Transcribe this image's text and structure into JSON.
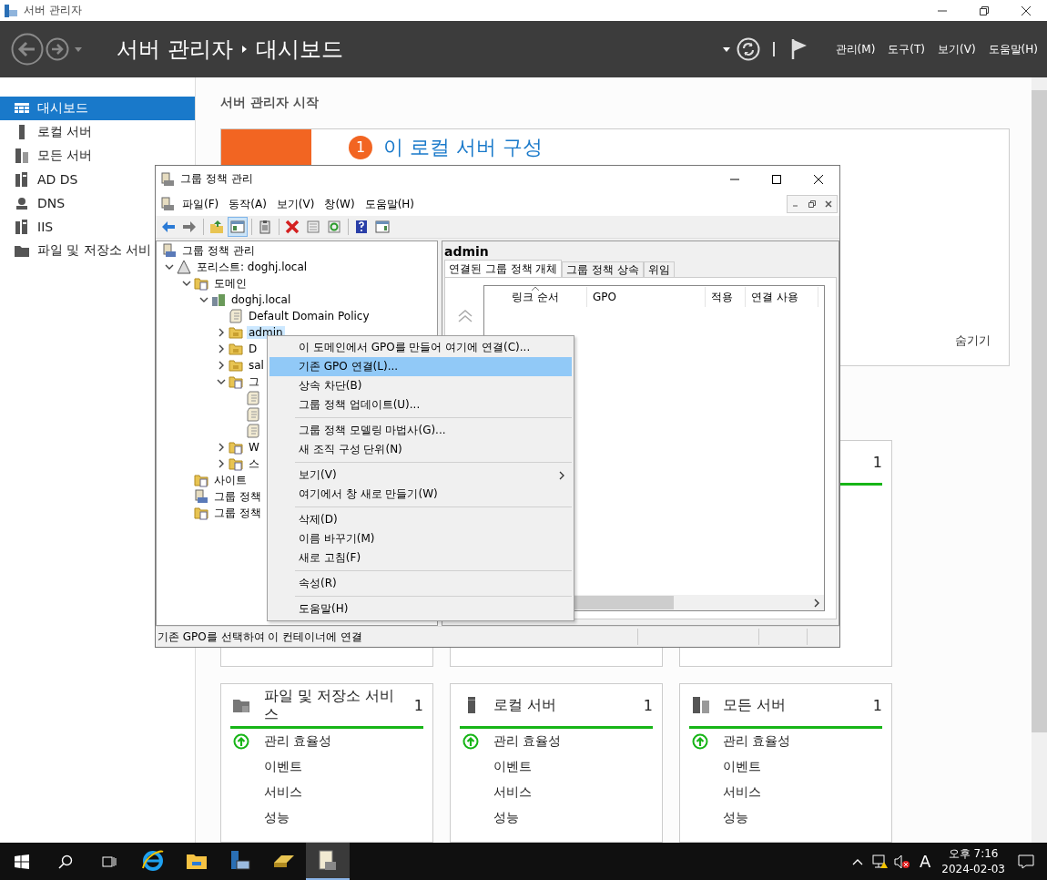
{
  "window": {
    "title": "서버 관리자"
  },
  "header": {
    "breadcrumb": [
      "서버 관리자",
      "대시보드"
    ],
    "menus": [
      "관리(M)",
      "도구(T)",
      "보기(V)",
      "도움말(H)"
    ]
  },
  "sidebar": {
    "items": [
      {
        "label": "대시보드",
        "kind": "dashboard",
        "selected": true
      },
      {
        "label": "로컬 서버",
        "kind": "local-server",
        "selected": false
      },
      {
        "label": "모든 서버",
        "kind": "all-servers",
        "selected": false
      },
      {
        "label": "AD DS",
        "kind": "ad-ds",
        "selected": false
      },
      {
        "label": "DNS",
        "kind": "dns",
        "selected": false
      },
      {
        "label": "IIS",
        "kind": "iis",
        "selected": false
      },
      {
        "label": "파일 및 저장소 서비",
        "kind": "file-storage",
        "selected": false
      }
    ]
  },
  "content": {
    "section_title": "서버 관리자 시작",
    "welcome": {
      "step": "1",
      "heading": "이 로컬 서버 구성",
      "hide_link": "숨기기"
    },
    "role_tile": {
      "count": "1"
    },
    "tiles": [
      {
        "title": "파일 및 저장소 서비스",
        "kind": "file-storage",
        "count": "1",
        "rows": [
          {
            "label": "관리 효율성",
            "healthy": true
          },
          {
            "label": "이벤트",
            "healthy": false
          },
          {
            "label": "서비스",
            "healthy": false
          },
          {
            "label": "성능",
            "healthy": false
          }
        ]
      },
      {
        "title": "로컬 서버",
        "kind": "local-server",
        "count": "1",
        "rows": [
          {
            "label": "관리 효율성",
            "healthy": true
          },
          {
            "label": "이벤트",
            "healthy": false
          },
          {
            "label": "서비스",
            "healthy": false
          },
          {
            "label": "성능",
            "healthy": false
          }
        ]
      },
      {
        "title": "모든 서버",
        "kind": "all-servers",
        "count": "1",
        "rows": [
          {
            "label": "관리 효율성",
            "healthy": true
          },
          {
            "label": "이벤트",
            "healthy": false
          },
          {
            "label": "서비스",
            "healthy": false
          },
          {
            "label": "성능",
            "healthy": false
          }
        ]
      }
    ]
  },
  "gpmc": {
    "title": "그룹 정책 관리",
    "menus": [
      "파일(F)",
      "동작(A)",
      "보기(V)",
      "창(W)",
      "도움말(H)"
    ],
    "toolbar": [
      {
        "kind": "back",
        "selected": false
      },
      {
        "kind": "forward",
        "selected": false
      },
      {
        "kind": "up-folder",
        "selected": false
      },
      {
        "kind": "console-tree",
        "selected": true
      },
      {
        "kind": "clipboard",
        "selected": false
      },
      {
        "kind": "delete",
        "selected": false
      },
      {
        "kind": "properties",
        "selected": false
      },
      {
        "kind": "refresh",
        "selected": false
      },
      {
        "kind": "help",
        "selected": false
      },
      {
        "kind": "action-pane",
        "selected": false
      }
    ],
    "tree": [
      {
        "label": "그룹 정책 관리",
        "kind": "console",
        "selected": false,
        "children": [
          {
            "label": "포리스트: doghj.local",
            "kind": "forest",
            "expanded": true,
            "selected": false,
            "children": [
              {
                "label": "도메인",
                "kind": "domains",
                "expanded": true,
                "selected": false,
                "children": [
                  {
                    "label": "doghj.local",
                    "kind": "domain",
                    "expanded": true,
                    "selected": false,
                    "children": [
                      {
                        "label": "Default Domain Policy",
                        "kind": "gpo-link",
                        "selected": false
                      },
                      {
                        "label": "admin",
                        "kind": "ou",
                        "expanded": false,
                        "selected": true
                      },
                      {
                        "label": "D",
                        "kind": "ou",
                        "expanded": false,
                        "selected": false
                      },
                      {
                        "label": "sal",
                        "kind": "ou",
                        "expanded": false,
                        "selected": false
                      },
                      {
                        "label": "그",
                        "kind": "gpo-folder",
                        "expanded": true,
                        "selected": false,
                        "children": [
                          {
                            "kind": "gpo",
                            "selected": false
                          },
                          {
                            "kind": "gpo",
                            "selected": false
                          },
                          {
                            "kind": "gpo",
                            "selected": false
                          }
                        ]
                      },
                      {
                        "label": "W",
                        "kind": "filter-folder",
                        "expanded": false,
                        "selected": false
                      },
                      {
                        "label": "스",
                        "kind": "starter-folder",
                        "expanded": false,
                        "selected": false
                      }
                    ]
                  }
                ]
              },
              {
                "label": "사이트",
                "kind": "sites",
                "selected": false
              },
              {
                "label": "그룹 정책",
                "kind": "modeling",
                "selected": false
              },
              {
                "label": "그룹 정책",
                "kind": "results",
                "selected": false
              }
            ]
          }
        ]
      }
    ],
    "detail": {
      "heading": "admin",
      "tabs": [
        {
          "label": "연결된 그룹 정책 개체",
          "selected": true
        },
        {
          "label": "그룹 정책 상속",
          "selected": false
        },
        {
          "label": "위임",
          "selected": false
        }
      ],
      "columns": [
        "링크 순서",
        "GPO",
        "적용",
        "연결 사용"
      ]
    },
    "status_bar": "기존 GPO를 선택하여 이 컨테이너에 연결",
    "context_menu": {
      "groups": [
        [
          {
            "label": "이 도메인에서 GPO를 만들어 여기에 연결(C)...",
            "selected": false
          },
          {
            "label": "기존 GPO 연결(L)...",
            "selected": true
          },
          {
            "label": "상속 차단(B)",
            "selected": false
          },
          {
            "label": "그룹 정책 업데이트(U)...",
            "selected": false
          }
        ],
        [
          {
            "label": "그룹 정책 모델링 마법사(G)...",
            "selected": false
          },
          {
            "label": "새 조직 구성 단위(N)",
            "selected": false
          }
        ],
        [
          {
            "label": "보기(V)",
            "selected": false,
            "submenu": true
          },
          {
            "label": "여기에서 창 새로 만들기(W)",
            "selected": false
          }
        ],
        [
          {
            "label": "삭제(D)",
            "selected": false
          },
          {
            "label": "이름 바꾸기(M)",
            "selected": false
          },
          {
            "label": "새로 고침(F)",
            "selected": false
          }
        ],
        [
          {
            "label": "속성(R)",
            "selected": false
          }
        ],
        [
          {
            "label": "도움말(H)",
            "selected": false
          }
        ]
      ]
    }
  },
  "taskbar": {
    "apps": [
      {
        "kind": "internet-explorer",
        "selected": false
      },
      {
        "kind": "file-explorer",
        "selected": false
      },
      {
        "kind": "server-manager",
        "selected": false
      },
      {
        "kind": "drive-tool",
        "selected": false
      },
      {
        "kind": "policy-console",
        "selected": true
      }
    ],
    "ime": "A",
    "time": "오후 7:16",
    "date": "2024-02-03"
  }
}
